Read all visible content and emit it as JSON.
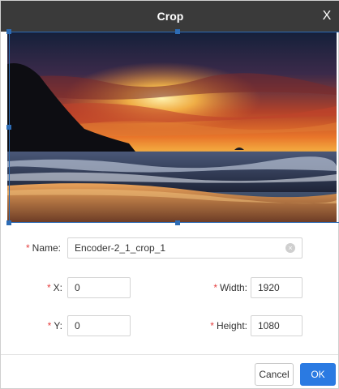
{
  "dialog": {
    "title": "Crop",
    "close_label": "X"
  },
  "form": {
    "required_mark": "*",
    "name": {
      "label": "Name:",
      "value": "Encoder-2_1_crop_1"
    },
    "x": {
      "label": "X:",
      "value": "0"
    },
    "y": {
      "label": "Y:",
      "value": "0"
    },
    "width": {
      "label": "Width:",
      "value": "1920"
    },
    "height": {
      "label": "Height:",
      "value": "1080"
    }
  },
  "buttons": {
    "cancel_label": "Cancel",
    "ok_label": "OK"
  },
  "colors": {
    "titlebar": "#3a3a3a",
    "accent": "#2a7ae2",
    "crop_frame": "#2d6cb5",
    "required": "#e53e3e"
  },
  "icons": {
    "close": "close-icon",
    "clear": "clear-icon"
  }
}
